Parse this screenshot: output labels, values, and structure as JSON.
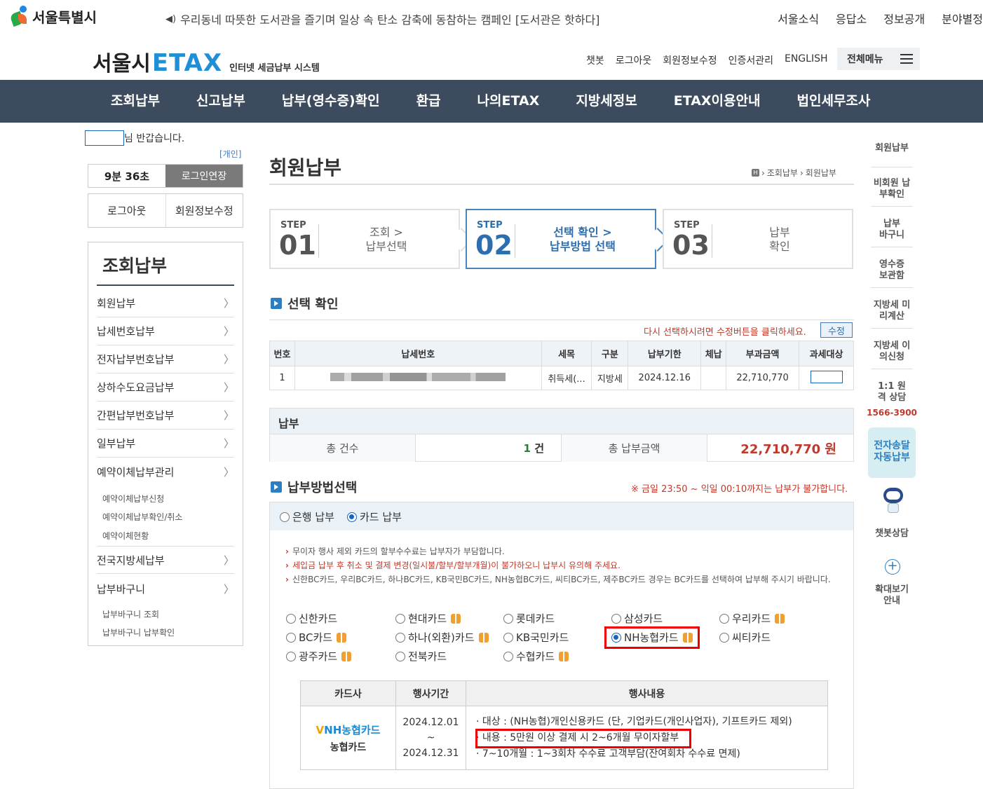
{
  "top": {
    "logo": "서울특별시",
    "notice": "우리동네 따뜻한 도서관을 즐기며 일상 속 탄소 감축에 동참하는 캠페인 [도서관은 핫하다]",
    "links": [
      "서울소식",
      "응답소",
      "정보공개",
      "분야별정"
    ]
  },
  "brand": {
    "seoul": "서울시",
    "etax": "ETAX",
    "sub": "인터넷 세금납부 시스템"
  },
  "util": [
    "챗봇",
    "로그아웃",
    "회원정보수정",
    "인증서관리",
    "ENGLISH"
  ],
  "allmenu": "전체메뉴",
  "gnb": [
    "조회납부",
    "신고납부",
    "납부(영수증)확인",
    "환급",
    "나의ETAX",
    "지방세정보",
    "ETAX이용안내",
    "법인세무조사"
  ],
  "user": {
    "welcome": "님 반갑습니다.",
    "type": "[개인]",
    "timer": "9분 36초",
    "extend": "로그인연장",
    "logout": "로그아웃",
    "edit": "회원정보수정"
  },
  "lnb": {
    "title": "조회납부",
    "items": [
      "회원납부",
      "납세번호납부",
      "전자납부번호납부",
      "상하수도요금납부",
      "간편납부번호납부",
      "일부납부",
      "예약이체납부관리",
      "전국지방세납부",
      "납부바구니"
    ],
    "sub_reserve": [
      "예약이체납부신청",
      "예약이체납부확인/취소",
      "예약이체현황"
    ],
    "sub_basket": [
      "납부바구니 조회",
      "납부바구니 납부확인"
    ]
  },
  "page": {
    "title": "회원납부",
    "breadcrumb": [
      "조회납부",
      "회원납부"
    ]
  },
  "steps": [
    {
      "label": "STEP",
      "num": "01",
      "line1": "조회 >",
      "line2": "납부선택"
    },
    {
      "label": "STEP",
      "num": "02",
      "line1": "선택 확인 >",
      "line2": "납부방법 선택"
    },
    {
      "label": "STEP",
      "num": "03",
      "line1": "납부",
      "line2": "확인"
    }
  ],
  "confirm": {
    "heading": "선택 확인",
    "hint": "다시 선택하시려면 수정버튼을 클릭하세요.",
    "edit": "수정",
    "headers": [
      "번호",
      "납세번호",
      "세목",
      "구분",
      "납부기한",
      "체납",
      "부과금액",
      "과세대상"
    ],
    "row": {
      "no": "1",
      "tax": "취득세(...",
      "kind": "지방세",
      "due": "2024.12.16",
      "arrears": "",
      "amount": "22,710,770"
    }
  },
  "pay": {
    "heading": "납부",
    "count_label": "총 건수",
    "count": "1",
    "count_unit": "건",
    "amount_label": "총 납부금액",
    "amount": "22,710,770 원"
  },
  "method": {
    "heading": "납부방법선택",
    "warn": "※ 금일 23:50 ~ 익일 00:10까지는 납부가 불가합니다.",
    "bank": "은행 납부",
    "card": "카드 납부",
    "notes": [
      "무이자 행사 제외 카드의 할부수수료는 납부자가 부담합니다.",
      "세입금 납부 후 취소 및 결제 변경(일시불/할부/할부개월)이 불가하오니 납부시 유의해 주세요.",
      "신한BC카드, 우리BC카드, 하나BC카드, KB국민BC카드, NH농협BC카드, 씨티BC카드, 제주BC카드 경우는 BC카드를 선택하여 납부해 주시기 바랍니다."
    ],
    "cards": [
      "신한카드",
      "현대카드",
      "롯데카드",
      "삼성카드",
      "우리카드",
      "BC카드",
      "하나(외환)카드",
      "KB국민카드",
      "NH농협카드",
      "씨티카드",
      "광주카드",
      "전북카드",
      "수협카드"
    ]
  },
  "event": {
    "headers": [
      "카드사",
      "행사기간",
      "행사내용"
    ],
    "logo": "NH농협카드",
    "name": "농협카드",
    "period_from": "2024.12.01",
    "tilde": "~",
    "period_to": "2024.12.31",
    "lines": [
      "· 대상 : (NH농협)개인신용카드 (단, 기업카드(개인사업자), 기프트카드 제외)",
      "· 내용 : 5만원 이상 결제 시 2~6개월 무이자할부",
      "· 7~10개월 : 1~3회차 수수료 고객부담(잔여회차 수수료 면제)"
    ]
  },
  "quick": [
    "회원납부",
    "비회원 납부확인",
    "납부 바구니",
    "영수증 보관함",
    "지방세 미리계산",
    "지방세 이의신청",
    "1:1 원격 상담",
    "1566-3900",
    "전자송달 자동납부",
    "챗봇상담",
    "확대보기 안내"
  ]
}
